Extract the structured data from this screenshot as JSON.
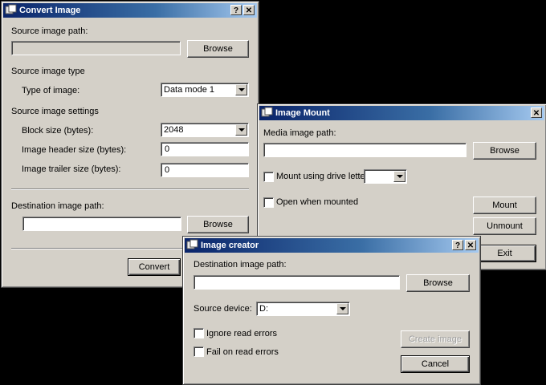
{
  "convert": {
    "title": "Convert Image",
    "help": "?",
    "close": "✕",
    "source_path_label": "Source image path:",
    "source_path_value": "",
    "browse_label": "Browse",
    "source_type_heading": "Source image type",
    "type_label": "Type of image:",
    "type_value": "Data mode 1",
    "settings_heading": "Source image settings",
    "block_size_label": "Block size (bytes):",
    "block_size_value": "2048",
    "header_size_label": "Image header size (bytes):",
    "header_size_value": "0",
    "trailer_size_label": "Image trailer size (bytes):",
    "trailer_size_value": "0",
    "dest_path_label": "Destination image path:",
    "dest_path_value": "",
    "dest_browse_label": "Browse",
    "convert_label": "Convert"
  },
  "mount": {
    "title": "Image Mount",
    "close": "✕",
    "media_path_label": "Media image path:",
    "media_path_value": "",
    "browse_label": "Browse",
    "drive_letter_label": "Mount using drive letter",
    "drive_letter_value": "",
    "open_when_mounted_label": "Open when mounted",
    "mount_label": "Mount",
    "unmount_label": "Unmount",
    "exit_label": "Exit"
  },
  "creator": {
    "title": "Image creator",
    "help": "?",
    "close": "✕",
    "dest_path_label": "Destination image path:",
    "dest_path_value": "",
    "browse_label": "Browse",
    "source_device_label": "Source device:",
    "source_device_value": "D:",
    "ignore_errors_label": "Ignore read errors",
    "fail_errors_label": "Fail on read errors",
    "create_label": "Create image",
    "cancel_label": "Cancel"
  }
}
